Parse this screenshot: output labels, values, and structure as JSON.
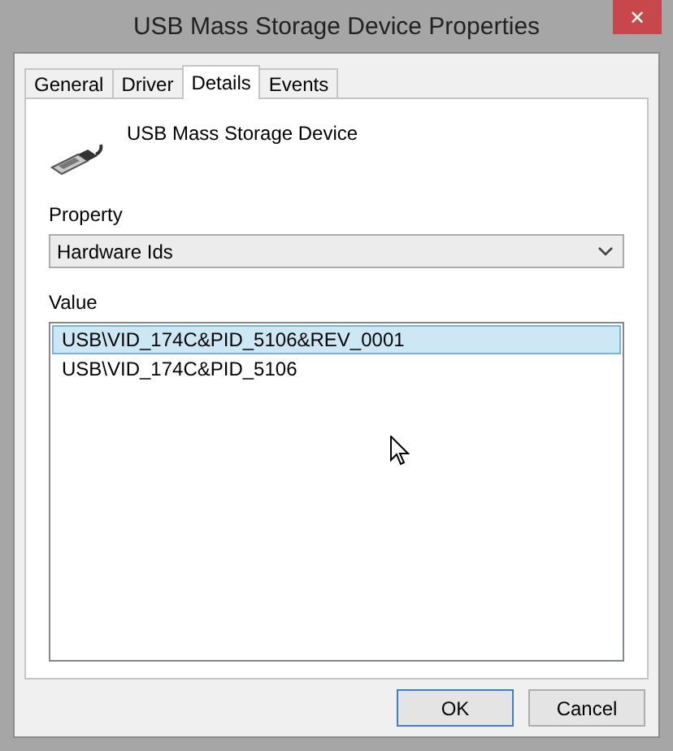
{
  "window": {
    "title": "USB Mass Storage Device Properties",
    "close": "✕"
  },
  "tabs": [
    {
      "label": "General",
      "selected": false
    },
    {
      "label": "Driver",
      "selected": false
    },
    {
      "label": "Details",
      "selected": true
    },
    {
      "label": "Events",
      "selected": false
    }
  ],
  "device_name": "USB Mass Storage Device",
  "property": {
    "label": "Property",
    "value": "Hardware Ids"
  },
  "value": {
    "label": "Value",
    "items": [
      {
        "text": "USB\\VID_174C&PID_5106&REV_0001",
        "selected": true
      },
      {
        "text": "USB\\VID_174C&PID_5106",
        "selected": false
      }
    ]
  },
  "buttons": [
    {
      "label": "OK",
      "default": true
    },
    {
      "label": "Cancel",
      "default": false
    }
  ]
}
